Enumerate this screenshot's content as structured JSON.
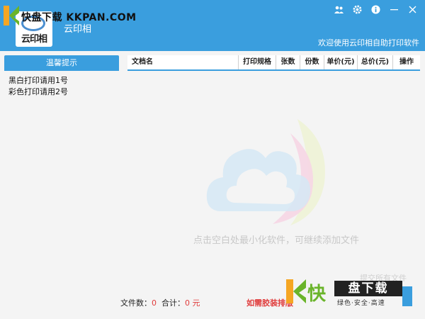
{
  "watermark": {
    "top_text": "快盘下载 KKPAN.COM",
    "bottom_kuai": "快",
    "bottom_pan": "盘下载",
    "bottom_sub": "绿色·安全·高速"
  },
  "header": {
    "logo_text": "云印相",
    "app_title": "云印相",
    "welcome": "欢迎使用云印相自助打印软件",
    "icons": [
      "user-group-icon",
      "gear-icon",
      "info-icon",
      "minimize-icon",
      "close-icon"
    ]
  },
  "sidebar": {
    "tab_label": "温馨提示",
    "tips": [
      "黑白打印请用1号",
      "彩色打印请用2号"
    ]
  },
  "table": {
    "columns": [
      "文档名",
      "打印规格",
      "张数",
      "份数",
      "单价(元)",
      "总价(元)",
      "操作"
    ]
  },
  "hint": "点击空白处最小化软件，可继续添加文件",
  "footer": {
    "files_label": "文件数：",
    "files_count": "0",
    "total_label": "合计：",
    "total_value": "0 元",
    "binding_note": "如需胶装排版",
    "upload_ghost": "提交所有文件"
  },
  "colors": {
    "accent": "#3a9ede",
    "alert": "#e03c3c"
  }
}
